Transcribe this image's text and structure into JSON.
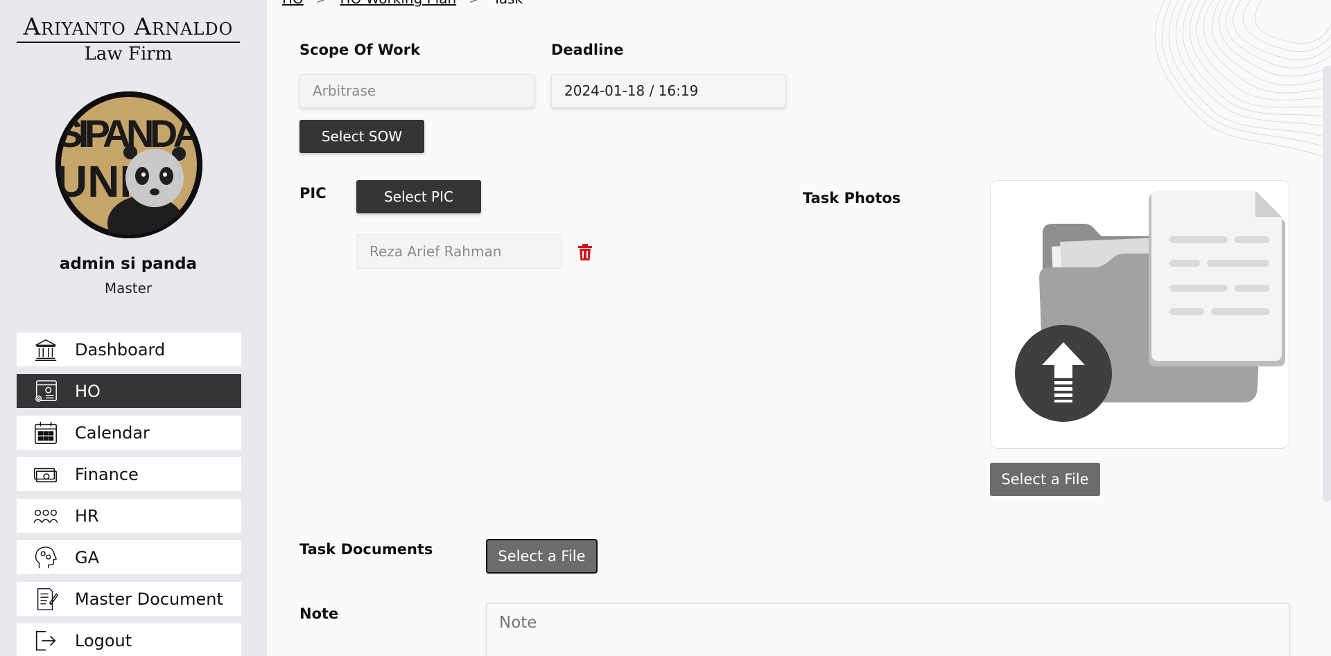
{
  "brand": {
    "line1": "Ariyanto Arnaldo",
    "line2": "Law Firm"
  },
  "profile": {
    "name": "admin si panda",
    "role": "Master",
    "avatar_text_1": "SIPANDA",
    "avatar_text_2": "UNIK"
  },
  "sidebar": {
    "items": [
      {
        "label": "Dashboard",
        "icon": "bank-icon",
        "active": false
      },
      {
        "label": "HO",
        "icon": "office-settings-icon",
        "active": true
      },
      {
        "label": "Calendar",
        "icon": "calendar-icon",
        "active": false
      },
      {
        "label": "Finance",
        "icon": "money-icon",
        "active": false
      },
      {
        "label": "HR",
        "icon": "people-icon",
        "active": false
      },
      {
        "label": "GA",
        "icon": "head-gears-icon",
        "active": false
      },
      {
        "label": "Master Document",
        "icon": "document-edit-icon",
        "active": false
      },
      {
        "label": "Logout",
        "icon": "logout-icon",
        "active": false
      }
    ]
  },
  "breadcrumb": {
    "items": [
      "HO",
      "HO Working Plan",
      "Task"
    ],
    "separator": ">"
  },
  "form": {
    "scope_label": "Scope Of Work",
    "scope_value": "Arbitrase",
    "deadline_label": "Deadline",
    "deadline_value": "2024-01-18 / 16:19",
    "select_sow": "Select SOW",
    "pic_label": "PIC",
    "select_pic": "Select PIC",
    "pic_value": "Reza Arief Rahman",
    "task_photos_label": "Task Photos",
    "select_photo_file": "Select a File",
    "task_documents_label": "Task Documents",
    "select_document_file": "Select a File",
    "note_label": "Note",
    "note_placeholder": "Note"
  },
  "colors": {
    "active_nav": "#353536",
    "delete": "#d0161b",
    "button_dark": "#353536",
    "button_grey": "#6c6c6d"
  }
}
